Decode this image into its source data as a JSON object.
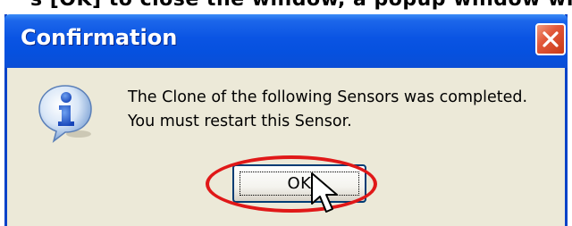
{
  "caption": "s [OK] to close the window, a popup window will appear",
  "dialog": {
    "title": "Confirmation",
    "close_icon": "close-icon",
    "message_line1": "The Clone of the following Sensors was completed.",
    "message_line2": "You must restart this Sensor.",
    "icon": "info-icon",
    "ok_label": "OK"
  },
  "annotation": {
    "highlight_color": "#e01818",
    "pointer_icon": "mouse-pointer-icon"
  },
  "colors": {
    "titlebar": "#0a54e3",
    "dialog_background": "#ece9d8",
    "close_button": "#e2583a"
  }
}
